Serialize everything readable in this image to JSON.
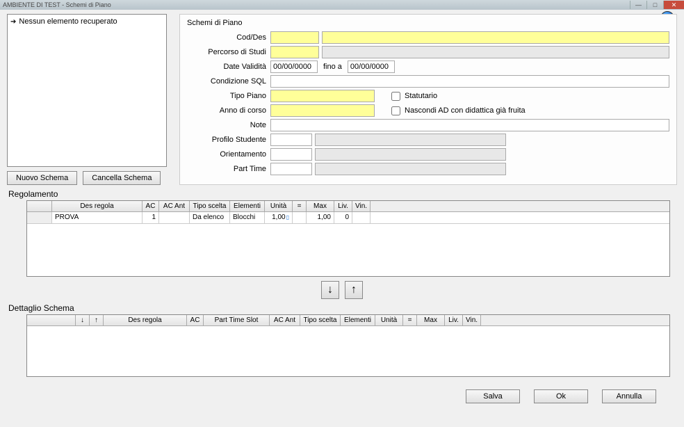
{
  "titlebar": {
    "title": "AMBIENTE DI TEST - Schemi di Piano"
  },
  "sidebar": {
    "empty_label": "Nessun elemento recuperato"
  },
  "buttons": {
    "nuovo_schema": "Nuovo Schema",
    "cancella_schema": "Cancella Schema",
    "salva": "Salva",
    "ok": "Ok",
    "annulla": "Annulla"
  },
  "form": {
    "panel_title": "Schemi di Piano",
    "labels": {
      "cod_des": "Cod/Des",
      "percorso": "Percorso di Studi",
      "date_validita": "Date Validità",
      "fino_a": "fino a",
      "condizione_sql": "Condizione SQL",
      "tipo_piano": "Tipo Piano",
      "anno_corso": "Anno di corso",
      "note": "Note",
      "profilo_studente": "Profilo Studente",
      "orientamento": "Orientamento",
      "part_time": "Part Time",
      "statutario": "Statutario",
      "nascondi_ad": "Nascondi AD con didattica già fruita"
    },
    "values": {
      "cod": "",
      "des": "",
      "percorso_code": "",
      "percorso_des": "",
      "date_from": "00/00/0000",
      "date_to": "00/00/0000",
      "condizione_sql": "",
      "tipo_piano": "",
      "anno_corso": "",
      "note": "",
      "profilo_code": "",
      "profilo_des": "",
      "orient_code": "",
      "orient_des": "",
      "pt_code": "",
      "pt_des": "",
      "statutario_checked": false,
      "nascondi_checked": false
    }
  },
  "sections": {
    "regolamento": "Regolamento",
    "dettaglio_schema": "Dettaglio Schema"
  },
  "regolamento_grid": {
    "headers": {
      "des": "Des regola",
      "ac": "AC",
      "ac_ant": "AC Ant",
      "tipo_scelta": "Tipo scelta",
      "elementi": "Elementi",
      "unita": "Unità",
      "eq": "=",
      "max": "Max",
      "liv": "Liv.",
      "vin": "Vin."
    },
    "rows": [
      {
        "des": "PROVA",
        "ac": "1",
        "ac_ant": "",
        "tipo_scelta": "Da elenco",
        "elementi": "Blocchi",
        "unita": "1,00",
        "eq": "",
        "max": "1,00",
        "liv": "0",
        "vin": ""
      }
    ]
  },
  "dettaglio_grid": {
    "headers": {
      "sort_down": "↓",
      "sort_up": "↑",
      "des": "Des regola",
      "ac": "AC",
      "part_time_slot": "Part Time Slot",
      "ac_ant": "AC Ant",
      "tipo_scelta": "Tipo scelta",
      "elementi": "Elementi",
      "unita": "Unità",
      "eq": "=",
      "max": "Max",
      "liv": "Liv.",
      "vin": "Vin."
    }
  }
}
